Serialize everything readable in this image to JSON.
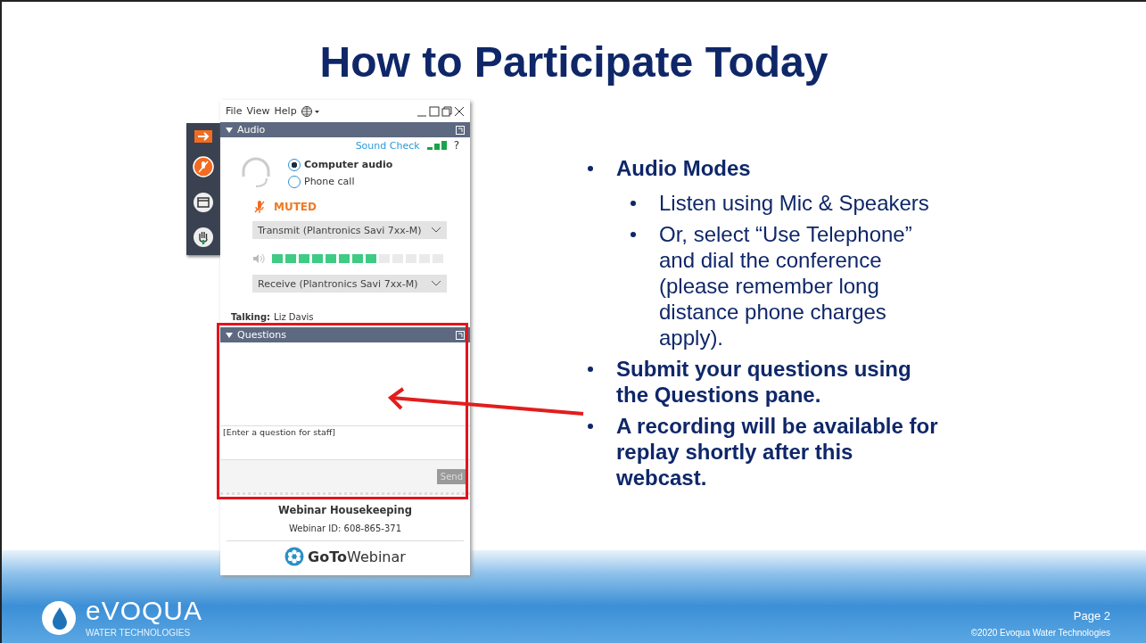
{
  "title": "How to Participate Today",
  "webinar_panel": {
    "menu": [
      "File",
      "View",
      "Help"
    ],
    "audio": {
      "title": "Audio",
      "sound_check": "Sound Check",
      "help": "?",
      "options": [
        {
          "label": "Computer audio",
          "selected": true
        },
        {
          "label": "Phone call",
          "selected": false
        }
      ],
      "mute_status": "MUTED",
      "transmit": "Transmit (Plantronics Savi 7xx-M)",
      "level": 0.615,
      "receive": "Receive (Plantronics Savi 7xx-M)",
      "talking_label": "Talking:",
      "talking_name": "Liz Davis"
    },
    "questions": {
      "title": "Questions",
      "placeholder": "[Enter a question for staff]",
      "send_button": "Send"
    },
    "footer": {
      "title": "Webinar Housekeeping",
      "webinar_id": "Webinar ID: 608-865-371",
      "logo": "**GoTo**Webinar"
    }
  },
  "bullets": [
    {
      "text": "Audio Modes",
      "bold": true,
      "children": [
        {
          "text": "Listen using Mic & Speakers",
          "bold": false
        },
        {
          "text": "Or, select “Use Telephone” and dial the conference (please remember long distance phone charges apply).",
          "bold": false
        }
      ]
    },
    {
      "text": "Submit your questions using the Questions pane.",
      "bold": true
    },
    {
      "text": "A recording will be available for replay shortly after this webcast.",
      "bold": true
    }
  ],
  "footer": {
    "brand": "eVOQUA",
    "tagline": "WATER TECHNOLOGIES",
    "page": "Page 2",
    "copyright": "©2020 Evoqua Water Technologies"
  }
}
